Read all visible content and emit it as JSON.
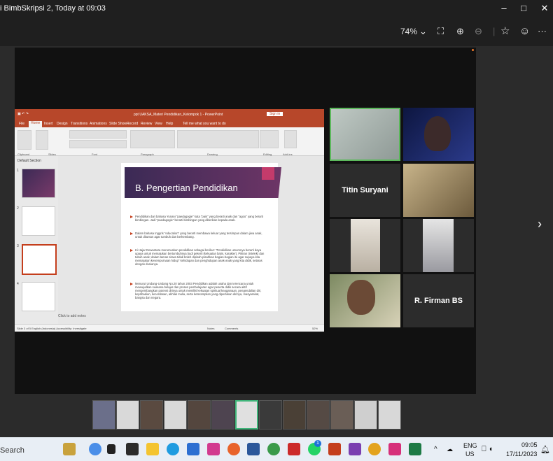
{
  "window": {
    "title": "i BimbSkripsi 2, Today at 09:03",
    "min": "–",
    "max": "□",
    "close": "✕"
  },
  "toolbar": {
    "zoom": "74%",
    "zoom_dropdown": "⌄",
    "fit_icon": "⛶",
    "zoom_in": "⊕",
    "zoom_out": "⊖",
    "favorite": "☆",
    "emoji": "☺",
    "more": "···"
  },
  "nav": {
    "next": "›"
  },
  "ppt": {
    "title": "ppt UAKSA_Materi Pendidikan_Kelompok 1 - PowerPoint",
    "signin": "Sign in",
    "tabs": [
      "File",
      "Home",
      "Insert",
      "Design",
      "Transitions",
      "Animations",
      "Slide Show",
      "Record",
      "Review",
      "View",
      "Help",
      "Tell me what you want to do"
    ],
    "groups": [
      "Clipboard",
      "Slides",
      "Font",
      "Paragraph",
      "Drawing",
      "Editing",
      "Add-ins"
    ],
    "section": "Default Section",
    "slide_numbers": [
      "1",
      "2",
      "3",
      "4"
    ],
    "slide": {
      "title": "B. Pengertian Pendidikan",
      "bullets": [
        "Pendidikan dari bahasa Yunani \"paedagogie\" kata \"pais\" yang berarti anak dan \"agoo\" yang berarti bimbingan. Jadi \"paedagogie\" berarti bimbingan yang diberikan kepada anak.",
        "Dalam bahasa Inggris \"education\" yang berarti membawa keluar yang tersimpan dalam jiwa anak, untuk dituntun agar tumbuh dan berkembang.",
        "Ki Hajar Dewantara merumuskan pendidikan sebagai berikut: \"Pendidikan umumnya berarti daya upaya untuk memajukan bertumbuhnya budi pekerti (kekuatan batin, karakter), Pikiran (intelek) dan tubuh anak; dalam taman siswa tidak boleh dipisah-pisahkan bagian-bagian itu agar supaya kita memajukan kesempurnaan hidup\" kehidupan dan penghidupan anak-anak yang kita didik, selaras dengan dunianya.",
        "Menurut Undang-Undang No.20 tahun 2003 Pendidikan adalah usaha dan terencana untuk mewujudkan suasana belajar dan proses pembelajaran agar peserta didik secara aktif mengembangkan potensi dirinya untuk memiliki kekuatan spiritual keagamaan, pengendalian diri, kepribadian, kecerdasan, akhlak mulia, serta keterampilan yang diperlukan dirinya, masyarakat, bangsa dan negara."
      ]
    },
    "notes": "Click to add notes",
    "status_left": "Slide 3 of 5   English (Indonesia)   Accessibility: Investigate",
    "status_notes": "Notes",
    "status_comments": "Comments",
    "status_zoom": "52%"
  },
  "participants": [
    {
      "name": ""
    },
    {
      "name": ""
    },
    {
      "name": "Titin Suryani"
    },
    {
      "name": ""
    },
    {
      "name": ""
    },
    {
      "name": ""
    },
    {
      "name": ""
    },
    {
      "name": "R. Firman BS"
    }
  ],
  "taskbar": {
    "search": "Search",
    "lang1": "ENG",
    "lang2": "US",
    "time": "09:05",
    "date": "17/11/2023",
    "up_arrow": "^",
    "whatsapp_badge": "1"
  },
  "colors": {
    "ppt_red": "#b7472a",
    "active_border": "#3fb57a"
  }
}
